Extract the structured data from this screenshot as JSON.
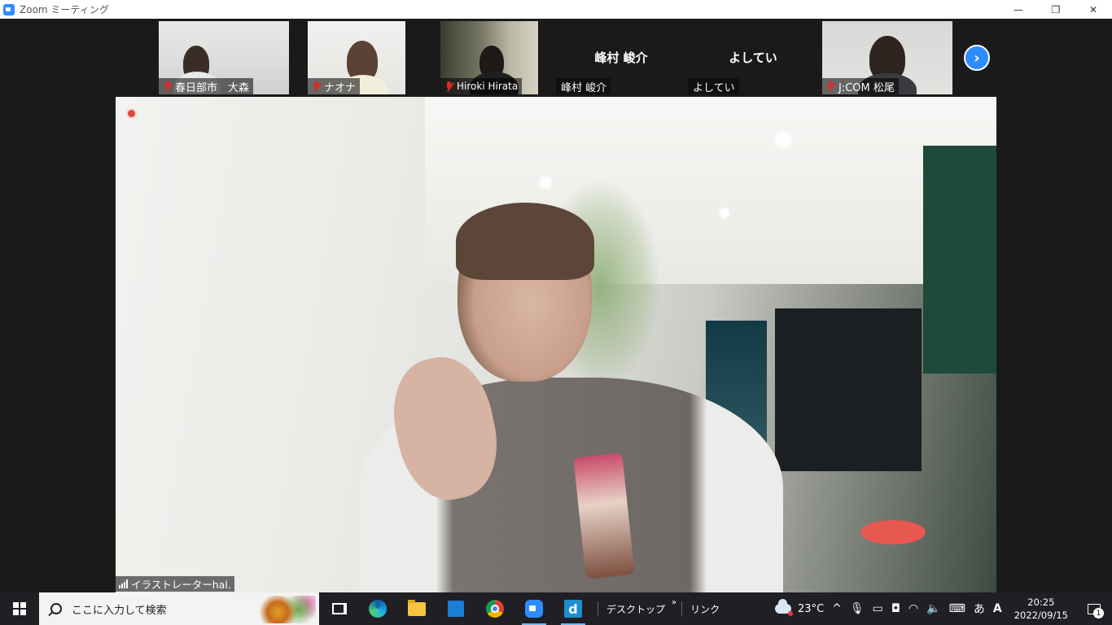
{
  "window": {
    "title": "Zoom ミーティング",
    "controls": [
      "—",
      "❐",
      "✕"
    ]
  },
  "participants": [
    {
      "name": "春日部市　大森",
      "muted": true,
      "video": true
    },
    {
      "name": "ナオナ",
      "muted": true,
      "video": true
    },
    {
      "name": "Hiroki Hirata",
      "muted": true,
      "video": true
    },
    {
      "name": "峰村 峻介",
      "muted": false,
      "video": false
    },
    {
      "name": "よしてい",
      "muted": false,
      "video": false
    },
    {
      "name": "J:COM 松尾",
      "muted": true,
      "video": true
    }
  ],
  "next_page_icon": "chevron-right-icon",
  "active_speaker": {
    "name": "イラストレーターhal."
  },
  "taskbar": {
    "search_placeholder": "ここに入力して検索",
    "toolbar_desktop": "デスクトップ",
    "toolbar_chevron": "»",
    "toolbar_link": "リンク",
    "weather_temp": "23°C",
    "tray_chevron": "^",
    "ime": "あ",
    "app_letter": "d",
    "adobe": "A",
    "time": "20:25",
    "date": "2022/09/15",
    "notification_count": "1"
  },
  "colors": {
    "zoom_blue": "#2d8cff",
    "mute_red": "#e02828",
    "taskbar_bg": "#1f1f24"
  }
}
